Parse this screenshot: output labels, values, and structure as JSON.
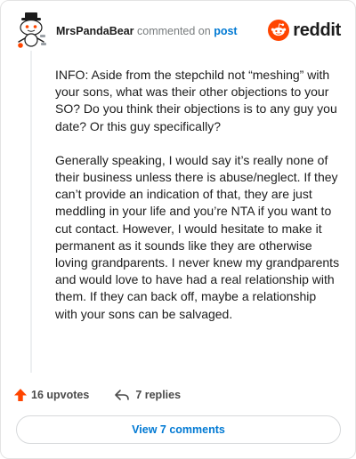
{
  "header": {
    "username": "MrsPandaBear",
    "action_text": "commented on",
    "post_link": "post",
    "brand": "reddit"
  },
  "comment": {
    "paragraphs": [
      "INFO: Aside from the stepchild not “meshing” with your sons, what was their other objections to your SO? Do you think their objections is to any guy you date? Or this guy specifically?",
      "Generally speaking, I would say it’s really none of their business unless there is abuse/neglect. If they can’t provide an indication of that, they are just meddling in your life and you’re NTA if you want to cut contact. However, I would hesitate to make it permanent as it sounds like they are otherwise loving grandparents. I never knew my grandparents and would love to have had a real relationship with them. If they can back off, maybe a relationship with your sons can be salvaged."
    ]
  },
  "footer": {
    "upvotes": "16 upvotes",
    "replies": "7 replies",
    "view_button": "View 7 comments"
  },
  "icons": {
    "avatar": "snoo-avatar-icon",
    "brand_logo": "reddit-logo-icon",
    "upvote": "upvote-arrow-icon",
    "reply": "reply-arrow-icon"
  },
  "colors": {
    "upvote": "#ff4500",
    "brand": "#ff4500",
    "link": "#0079d3",
    "muted": "#787c7e"
  }
}
